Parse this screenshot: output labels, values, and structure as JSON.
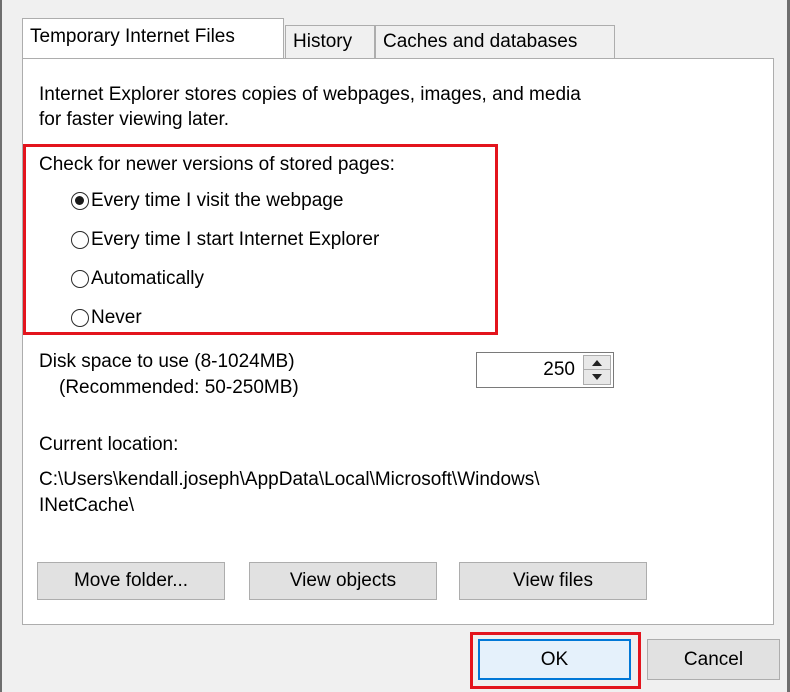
{
  "tabs": [
    {
      "label": "Temporary Internet Files",
      "active": true
    },
    {
      "label": "History",
      "active": false
    },
    {
      "label": "Caches and databases",
      "active": false
    }
  ],
  "description": {
    "line1": "Internet Explorer stores copies of webpages, images, and media",
    "line2": "for faster viewing later."
  },
  "check_group": {
    "heading": "Check for newer versions of stored pages:",
    "options": [
      {
        "label": "Every time I visit the webpage",
        "checked": true
      },
      {
        "label": "Every time I start Internet Explorer",
        "checked": false
      },
      {
        "label": "Automatically",
        "checked": false
      },
      {
        "label": "Never",
        "checked": false
      }
    ]
  },
  "disk_space": {
    "label": "Disk space to use (8-1024MB)",
    "recommended": "(Recommended: 50-250MB)",
    "value": "250"
  },
  "location": {
    "label": "Current location:",
    "path_line1": "C:\\Users\\kendall.joseph\\AppData\\Local\\Microsoft\\Windows\\",
    "path_line2": "INetCache\\"
  },
  "buttons": {
    "move_folder": "Move folder...",
    "view_objects": "View objects",
    "view_files": "View files",
    "ok": "OK",
    "cancel": "Cancel"
  },
  "colors": {
    "highlight": "#e3141d",
    "default_button_border": "#0078d7",
    "panel_bg": "#ffffff",
    "dialog_bg": "#f0f0f0"
  }
}
